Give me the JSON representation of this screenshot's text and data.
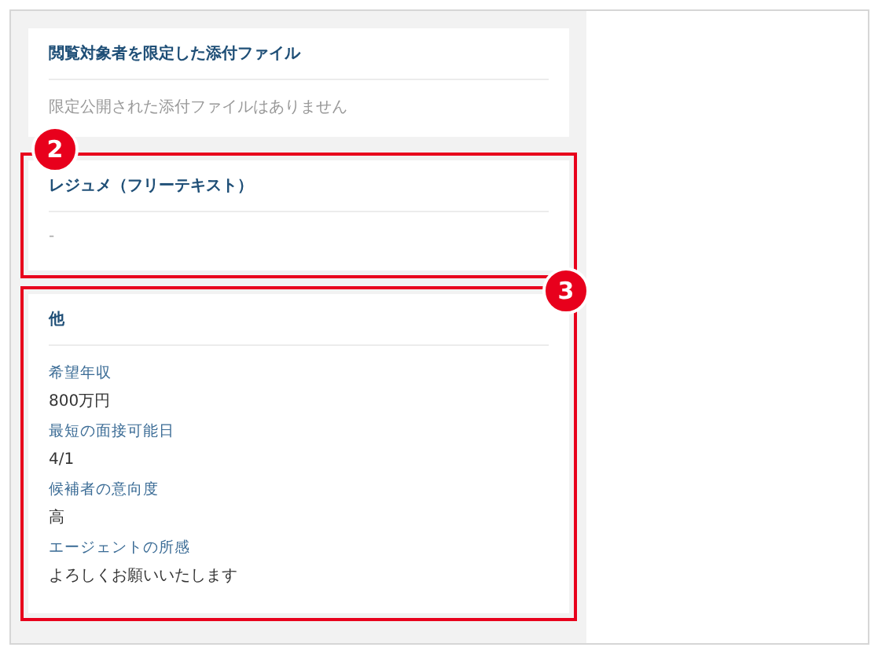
{
  "sections": [
    {
      "kind": "empty",
      "title": "閲覧対象者を限定した添付ファイル",
      "text": "限定公開された添付ファイルはありません"
    },
    {
      "kind": "text",
      "title": "レジュメ（フリーテキスト）",
      "text": "-",
      "marker": {
        "label": "2",
        "kind": "left"
      }
    },
    {
      "kind": "fields",
      "title": "他",
      "fields": [
        {
          "label": "希望年収",
          "value": "800万円"
        },
        {
          "label": "最短の面接可能日",
          "value": "4/1"
        },
        {
          "label": "候補者の意向度",
          "value": "高"
        },
        {
          "label": "エージェントの所感",
          "value": "よろしくお願いいたします"
        }
      ],
      "marker": {
        "label": "3",
        "kind": "right"
      }
    }
  ]
}
